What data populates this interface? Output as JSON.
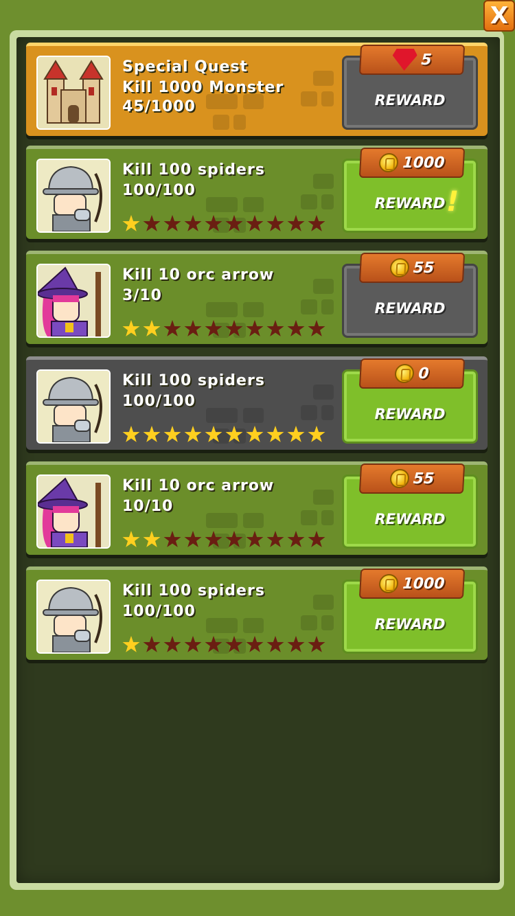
{
  "close_label": "X",
  "reward_label": "REWARD",
  "quests": [
    {
      "style": "gold",
      "portrait": "castle",
      "title": "Special Quest",
      "subtitle": "Kill 1000 Monster",
      "progress": "45/1000",
      "stars": null,
      "reward_icon": "gem-icon",
      "reward_amount": "5",
      "button_state": "disabled",
      "alert": false
    },
    {
      "style": "green",
      "portrait": "knight",
      "title": "Kill 100 spiders",
      "progress": "100/100",
      "stars": 1,
      "reward_icon": "coin-icon",
      "reward_amount": "1000",
      "button_state": "active",
      "alert": true
    },
    {
      "style": "green",
      "portrait": "witch",
      "title": "Kill 10 orc arrow",
      "progress": "3/10",
      "stars": 2,
      "reward_icon": "coin-icon",
      "reward_amount": "55",
      "button_state": "disabled",
      "alert": false
    },
    {
      "style": "gray",
      "portrait": "knight",
      "title": "Kill 100 spiders",
      "progress": "100/100",
      "stars": 10,
      "reward_icon": "coin-icon",
      "reward_amount": "0",
      "button_state": "active",
      "alert": false
    },
    {
      "style": "green",
      "portrait": "witch",
      "title": "Kill 10 orc arrow",
      "progress": "10/10",
      "stars": 2,
      "reward_icon": "coin-icon",
      "reward_amount": "55",
      "button_state": "active",
      "alert": false
    },
    {
      "style": "green",
      "portrait": "knight",
      "title": "Kill 100 spiders",
      "progress": "100/100",
      "stars": 1,
      "reward_icon": "coin-icon",
      "reward_amount": "1000",
      "button_state": "active",
      "alert": false
    }
  ],
  "max_stars": 10,
  "colors": {
    "star_on": "#ffcf1f",
    "star_off": "#6a1e12",
    "button_active": "#7fbf2a",
    "button_disabled": "#5b5b5b"
  }
}
